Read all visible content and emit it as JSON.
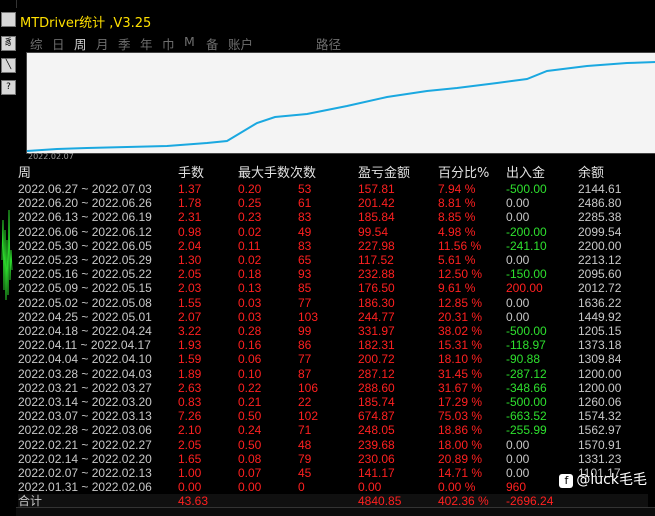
{
  "left_buttons": [
    "",
    "豸",
    "╲",
    "?"
  ],
  "title": "MTDriver统计 ,V3.25",
  "menu": {
    "items": [
      "综",
      "日",
      "周",
      "月",
      "季",
      "年",
      "巾",
      "M",
      "备",
      "账户",
      "路径"
    ],
    "active": "周"
  },
  "chart": {
    "start_date": "2022.02.07",
    "line_color": "#1aa8e0"
  },
  "table": {
    "headers": [
      "周",
      "手数",
      "最大手数",
      "次数",
      "盈亏金额",
      "百分比%",
      "出入金",
      "余额"
    ],
    "rows": [
      [
        "2022.06.27 ~ 2022.07.03",
        "1.37",
        "0.20",
        "53",
        "157.81",
        "7.94 %",
        "-500.00",
        "2144.61"
      ],
      [
        "2022.06.20 ~ 2022.06.26",
        "1.78",
        "0.25",
        "61",
        "201.42",
        "8.81 %",
        "0.00",
        "2486.80"
      ],
      [
        "2022.06.13 ~ 2022.06.19",
        "2.31",
        "0.23",
        "83",
        "185.84",
        "8.85 %",
        "0.00",
        "2285.38"
      ],
      [
        "2022.06.06 ~ 2022.06.12",
        "0.98",
        "0.02",
        "49",
        "99.54",
        "4.98 %",
        "-200.00",
        "2099.54"
      ],
      [
        "2022.05.30 ~ 2022.06.05",
        "2.04",
        "0.11",
        "83",
        "227.98",
        "11.56 %",
        "-241.10",
        "2200.00"
      ],
      [
        "2022.05.23 ~ 2022.05.29",
        "1.30",
        "0.02",
        "65",
        "117.52",
        "5.61 %",
        "0.00",
        "2213.12"
      ],
      [
        "2022.05.16 ~ 2022.05.22",
        "2.05",
        "0.18",
        "93",
        "232.88",
        "12.50 %",
        "-150.00",
        "2095.60"
      ],
      [
        "2022.05.09 ~ 2022.05.15",
        "2.03",
        "0.13",
        "85",
        "176.50",
        "9.61 %",
        "200.00",
        "2012.72"
      ],
      [
        "2022.05.02 ~ 2022.05.08",
        "1.55",
        "0.03",
        "77",
        "186.30",
        "12.85 %",
        "0.00",
        "1636.22"
      ],
      [
        "2022.04.25 ~ 2022.05.01",
        "2.07",
        "0.03",
        "103",
        "244.77",
        "20.31 %",
        "0.00",
        "1449.92"
      ],
      [
        "2022.04.18 ~ 2022.04.24",
        "3.22",
        "0.28",
        "99",
        "331.97",
        "38.02 %",
        "-500.00",
        "1205.15"
      ],
      [
        "2022.04.11 ~ 2022.04.17",
        "1.93",
        "0.16",
        "86",
        "182.31",
        "15.31 %",
        "-118.97",
        "1373.18"
      ],
      [
        "2022.04.04 ~ 2022.04.10",
        "1.59",
        "0.06",
        "77",
        "200.72",
        "18.10 %",
        "-90.88",
        "1309.84"
      ],
      [
        "2022.03.28 ~ 2022.04.03",
        "1.89",
        "0.10",
        "87",
        "287.12",
        "31.45 %",
        "-287.12",
        "1200.00"
      ],
      [
        "2022.03.21 ~ 2022.03.27",
        "2.63",
        "0.22",
        "106",
        "288.60",
        "31.67 %",
        "-348.66",
        "1200.00"
      ],
      [
        "2022.03.14 ~ 2022.03.20",
        "0.83",
        "0.21",
        "22",
        "185.74",
        "17.29 %",
        "-500.00",
        "1260.06"
      ],
      [
        "2022.03.07 ~ 2022.03.13",
        "7.26",
        "0.50",
        "102",
        "674.87",
        "75.03 %",
        "-663.52",
        "1574.32"
      ],
      [
        "2022.02.28 ~ 2022.03.06",
        "2.10",
        "0.24",
        "71",
        "248.05",
        "18.86 %",
        "-255.99",
        "1562.97"
      ],
      [
        "2022.02.21 ~ 2022.02.27",
        "2.05",
        "0.50",
        "48",
        "239.68",
        "18.00 %",
        "0.00",
        "1570.91"
      ],
      [
        "2022.02.14 ~ 2022.02.20",
        "1.65",
        "0.08",
        "79",
        "230.06",
        "20.89 %",
        "0.00",
        "1331.23"
      ],
      [
        "2022.02.07 ~ 2022.02.13",
        "1.00",
        "0.07",
        "45",
        "141.17",
        "14.71 %",
        "0.00",
        "1101.17"
      ],
      [
        "2022.01.31 ~ 2022.02.06",
        "0.00",
        "0.00",
        "0",
        "0.00",
        "0.00 %",
        "960",
        ""
      ]
    ],
    "total": [
      "合计",
      "43.63",
      "",
      "",
      "4840.85",
      "402.36 %",
      "-2696.24",
      ""
    ]
  },
  "watermark": {
    "icon": "f",
    "text": "@luck毛毛"
  }
}
